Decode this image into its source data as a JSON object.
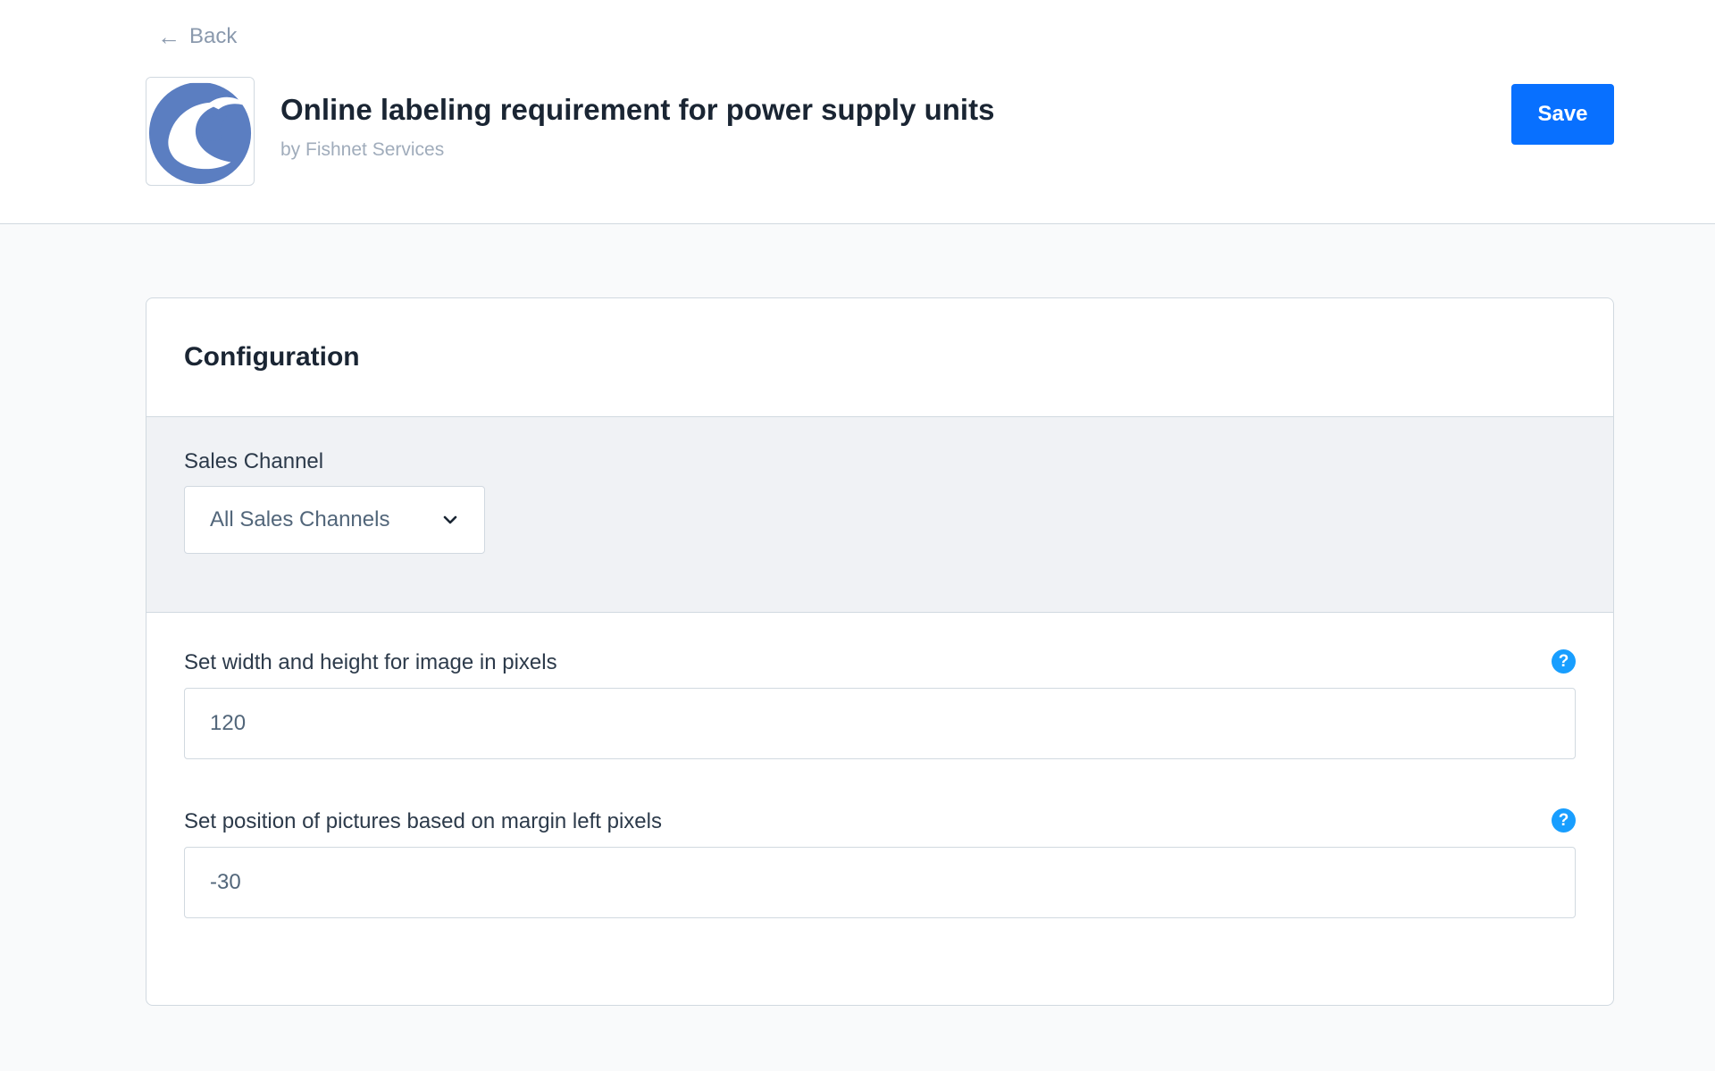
{
  "header": {
    "back_label": "Back",
    "app_title": "Online labeling requirement for power supply units",
    "app_vendor": "by Fishnet Services",
    "save_label": "Save"
  },
  "card": {
    "title": "Configuration",
    "sales_channel": {
      "label": "Sales Channel",
      "selected": "All Sales Channels"
    },
    "fields": [
      {
        "label": "Set width and height for image in pixels",
        "value": "120"
      },
      {
        "label": "Set position of pictures based on margin left pixels",
        "value": "-30"
      }
    ]
  },
  "colors": {
    "accent": "#0870ff",
    "help": "#189eff",
    "logo": "#5b7ec1"
  }
}
